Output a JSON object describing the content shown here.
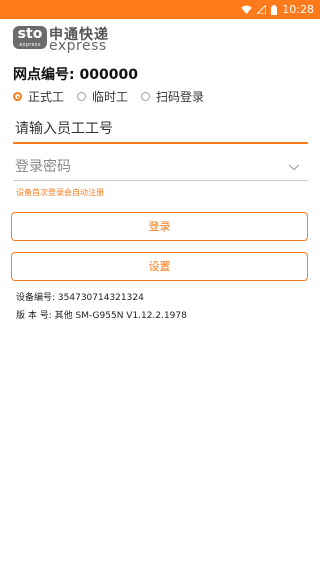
{
  "status_bar": {
    "time": "10:28",
    "icons": [
      "wifi-icon",
      "signal-icon",
      "battery-icon"
    ]
  },
  "logo": {
    "mark": "sto",
    "mark_sub": "express",
    "name_cn": "申通快递",
    "name_en": "express"
  },
  "branch": {
    "label": "网点编号:",
    "value": "000000"
  },
  "login_type": {
    "options": [
      {
        "label": "正式工",
        "selected": true
      },
      {
        "label": "临时工",
        "selected": false
      },
      {
        "label": "扫码登录",
        "selected": false
      }
    ]
  },
  "employee_id": {
    "placeholder": "请输入员工工号",
    "value": ""
  },
  "password": {
    "placeholder": "登录密码",
    "value": ""
  },
  "hint": "设备首次登录会自动注册",
  "buttons": {
    "login": "登录",
    "settings": "设置"
  },
  "device": {
    "label": "设备编号:",
    "value": "354730714321324"
  },
  "version": {
    "label": "版 本 号:",
    "value": "其他 SM-G955N V1.12.2.1978"
  },
  "colors": {
    "accent": "#ff7a1a",
    "status_bar": "#ff7a1a"
  }
}
